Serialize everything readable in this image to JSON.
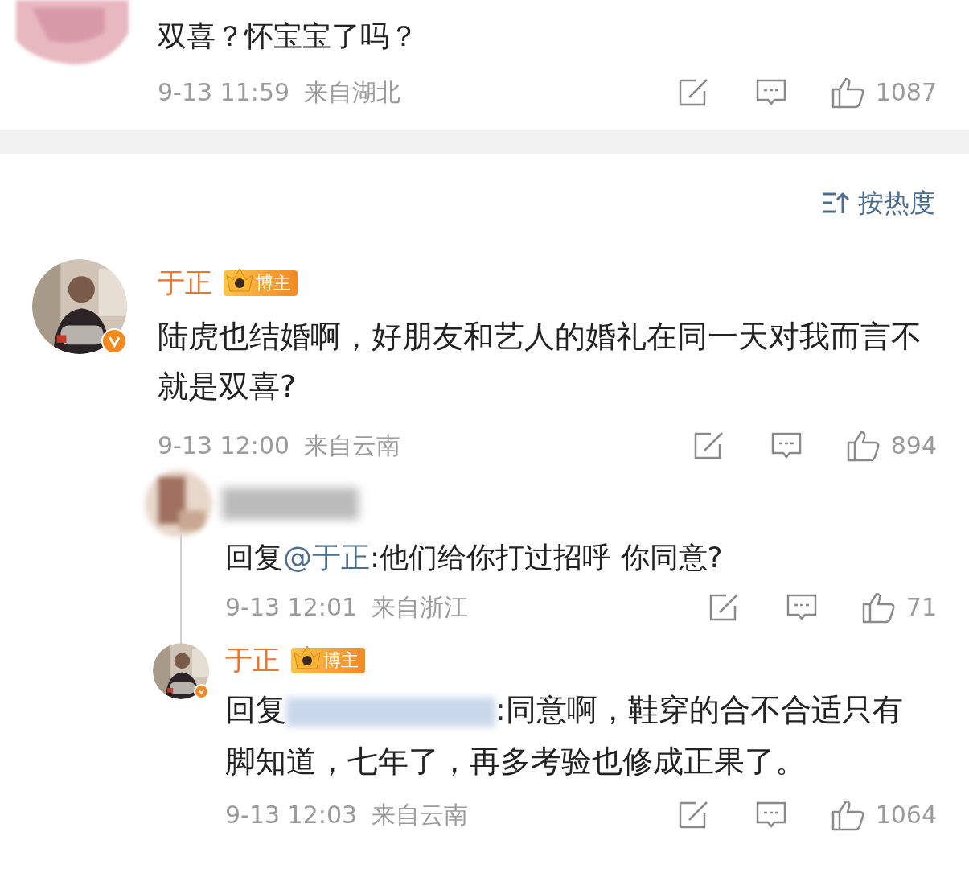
{
  "top_comment": {
    "text": "双喜？怀宝宝了吗？",
    "time": "9-13 11:59",
    "location": "来自湖北",
    "likes": "1087"
  },
  "sort": {
    "label": "按热度"
  },
  "comments": [
    {
      "name": "于正",
      "badge": "博主",
      "verified": true,
      "text": "陆虎也结婚啊，好朋友和艺人的婚礼在同一天对我而言不就是双喜?",
      "time": "9-13 12:00",
      "location": "来自云南",
      "likes": "894",
      "replies": [
        {
          "kind": "redacted",
          "reply_prefix": "回复",
          "mention": "@于正",
          "text": ":他们给你打过招呼 你同意?",
          "time": "9-13 12:01",
          "location": "来自浙江",
          "likes": "71"
        },
        {
          "kind": "author",
          "name": "于正",
          "badge": "博主",
          "verified": true,
          "reply_prefix": "回复",
          "text": ":同意啊，鞋穿的合不合适只有脚知道，七年了，再多考验也修成正果了。",
          "time": "9-13 12:03",
          "location": "来自云南",
          "likes": "1064"
        }
      ]
    }
  ]
}
